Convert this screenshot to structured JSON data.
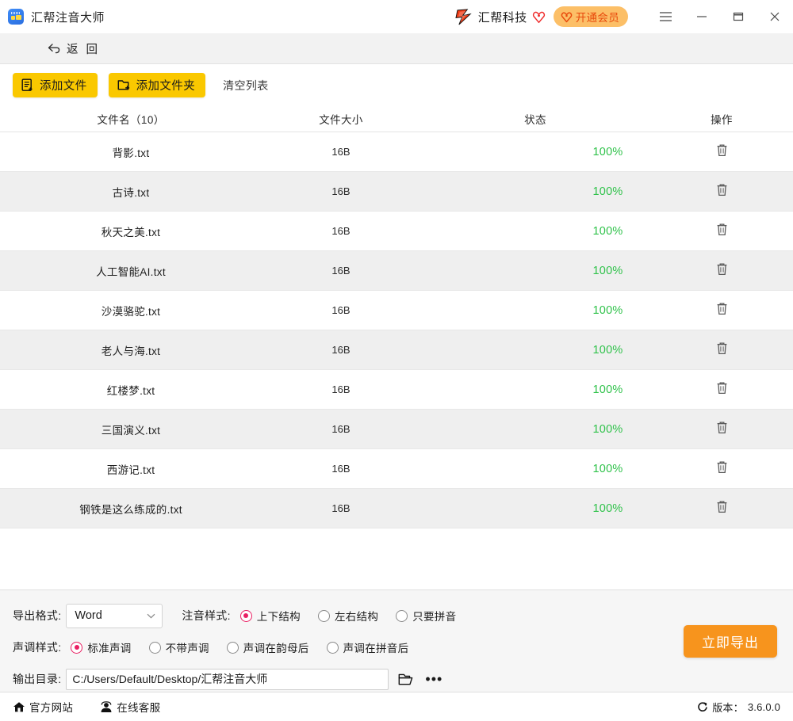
{
  "window": {
    "app_title": "汇帮注音大师",
    "app_icon": "app-logo-icon",
    "brand_name": "汇帮科技",
    "brand_logo_icon": "lightning-brand-icon",
    "brand_heart_icon": "heart-outline-icon",
    "vip_label": "开通会员",
    "vip_icon": "vip-heart-icon",
    "menu_icon": "hamburger-menu-icon",
    "minimize_icon": "minimize-icon",
    "maximize_icon": "maximize-icon",
    "close_icon": "close-icon"
  },
  "backbar": {
    "label": "返 回",
    "icon": "back-arrow-icon"
  },
  "toolbar": {
    "add_file_label": "添加文件",
    "add_file_icon": "add-file-icon",
    "add_folder_label": "添加文件夹",
    "add_folder_icon": "add-folder-icon",
    "clear_list_label": "清空列表"
  },
  "table": {
    "headers": {
      "name": "文件名（10）",
      "size": "文件大小",
      "status": "状态",
      "action": "操作"
    },
    "rows": [
      {
        "name": "背影.txt",
        "size": "16B",
        "progress": 100,
        "percent": "100%",
        "delete_icon": "trash-icon"
      },
      {
        "name": "古诗.txt",
        "size": "16B",
        "progress": 100,
        "percent": "100%",
        "delete_icon": "trash-icon"
      },
      {
        "name": "秋天之美.txt",
        "size": "16B",
        "progress": 100,
        "percent": "100%",
        "delete_icon": "trash-icon"
      },
      {
        "name": "人工智能AI.txt",
        "size": "16B",
        "progress": 100,
        "percent": "100%",
        "delete_icon": "trash-icon"
      },
      {
        "name": "沙漠骆驼.txt",
        "size": "16B",
        "progress": 100,
        "percent": "100%",
        "delete_icon": "trash-icon"
      },
      {
        "name": "老人与海.txt",
        "size": "16B",
        "progress": 100,
        "percent": "100%",
        "delete_icon": "trash-icon"
      },
      {
        "name": "红楼梦.txt",
        "size": "16B",
        "progress": 100,
        "percent": "100%",
        "delete_icon": "trash-icon"
      },
      {
        "name": "三国演义.txt",
        "size": "16B",
        "progress": 100,
        "percent": "100%",
        "delete_icon": "trash-icon"
      },
      {
        "name": "西游记.txt",
        "size": "16B",
        "progress": 100,
        "percent": "100%",
        "delete_icon": "trash-icon"
      },
      {
        "name": "钢铁是这么练成的.txt",
        "size": "16B",
        "progress": 100,
        "percent": "100%",
        "delete_icon": "trash-icon"
      }
    ]
  },
  "options": {
    "export_format_label": "导出格式:",
    "export_format_value": "Word",
    "export_format_options": [
      "Word"
    ],
    "phonetic_style_label": "注音样式:",
    "phonetic_styles": [
      {
        "label": "上下结构",
        "selected": true
      },
      {
        "label": "左右结构",
        "selected": false
      },
      {
        "label": "只要拼音",
        "selected": false
      }
    ],
    "tone_style_label": "声调样式:",
    "tone_styles": [
      {
        "label": "标准声调",
        "selected": true
      },
      {
        "label": "不带声调",
        "selected": false
      },
      {
        "label": "声调在韵母后",
        "selected": false
      },
      {
        "label": "声调在拼音后",
        "selected": false
      }
    ],
    "output_dir_label": "输出目录:",
    "output_dir_value": "C:/Users/Default/Desktop/汇帮注音大师",
    "folder_icon": "open-folder-icon",
    "more_icon": "more-dots-icon",
    "export_button_label": "立即导出"
  },
  "statusbar": {
    "website_label": "官方网站",
    "website_icon": "home-icon",
    "support_label": "在线客服",
    "support_icon": "customer-service-icon",
    "version_label": "版本：",
    "version_value": "3.6.0.0",
    "refresh_icon": "refresh-icon"
  },
  "colors": {
    "accent_yellow": "#fac800",
    "accent_orange": "#f7941d",
    "vip_bg": "#fcbf67",
    "progress_pink": "#e92063",
    "percent_green": "#2fc24a",
    "row_alt": "#efefef"
  }
}
